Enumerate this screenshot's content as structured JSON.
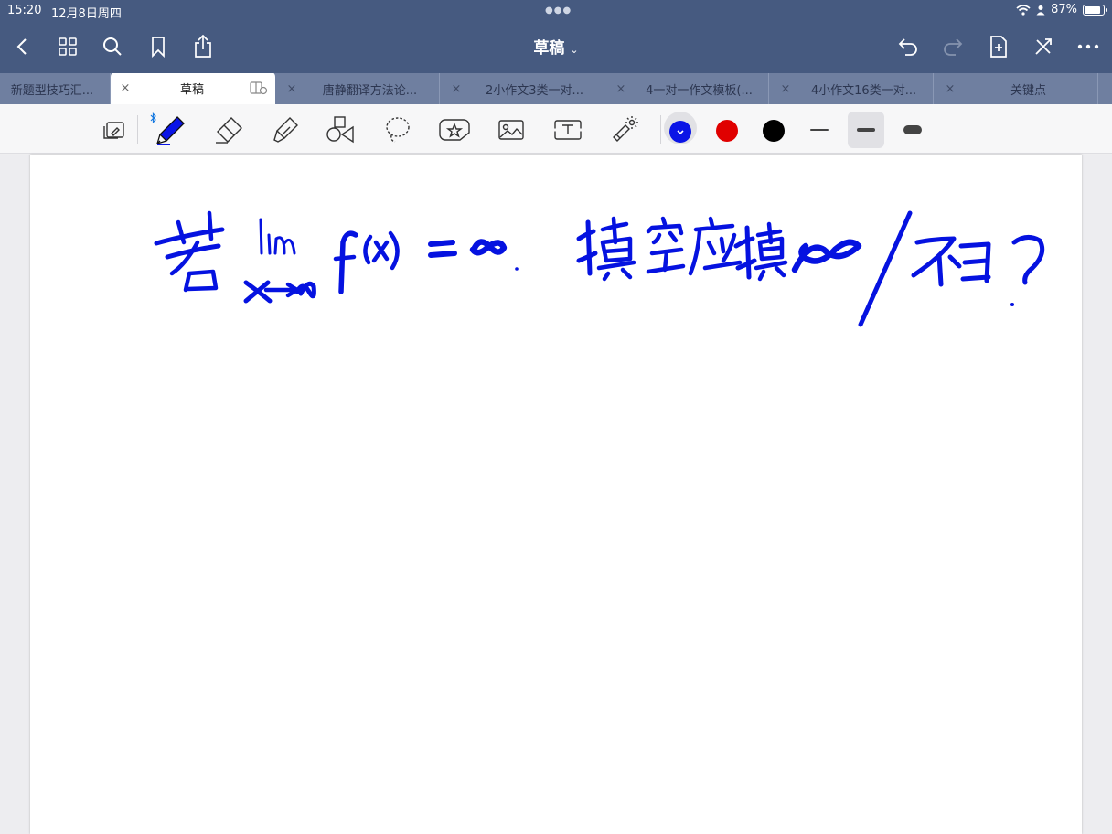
{
  "status": {
    "time": "15:20",
    "date": "12月8日周四",
    "battery": "87%",
    "battery_level": 0.87
  },
  "navbar": {
    "title": "草稿",
    "left_icons": [
      "back-chevron-icon",
      "grid-icon",
      "search-icon",
      "bookmark-icon",
      "share-icon"
    ],
    "right_icons": [
      "undo-icon",
      "redo-icon",
      "add-page-icon",
      "close-toolbar-icon",
      "more-icon"
    ]
  },
  "tabs": [
    {
      "label": "新题型技巧汇..."
    },
    {
      "label": "草稿",
      "active": true
    },
    {
      "label": "唐静翻译方法论..."
    },
    {
      "label": "2小作文3类一对..."
    },
    {
      "label": "4一对一作文模板(..."
    },
    {
      "label": "4小作文16类一对..."
    },
    {
      "label": "关键点"
    }
  ],
  "toolbar": {
    "tools": [
      "read-only-mode",
      "pen",
      "eraser",
      "highlighter",
      "shapes",
      "lasso",
      "sticker",
      "image",
      "text",
      "laser-pointer"
    ],
    "selected_tool": "pen",
    "colors": [
      "#0a14e6",
      "#e00000",
      "#000000"
    ],
    "selected_color": "#0a14e6",
    "stroke_widths": [
      "thin",
      "medium",
      "thick"
    ],
    "selected_width": "medium"
  },
  "ink_color": "#0512e0"
}
